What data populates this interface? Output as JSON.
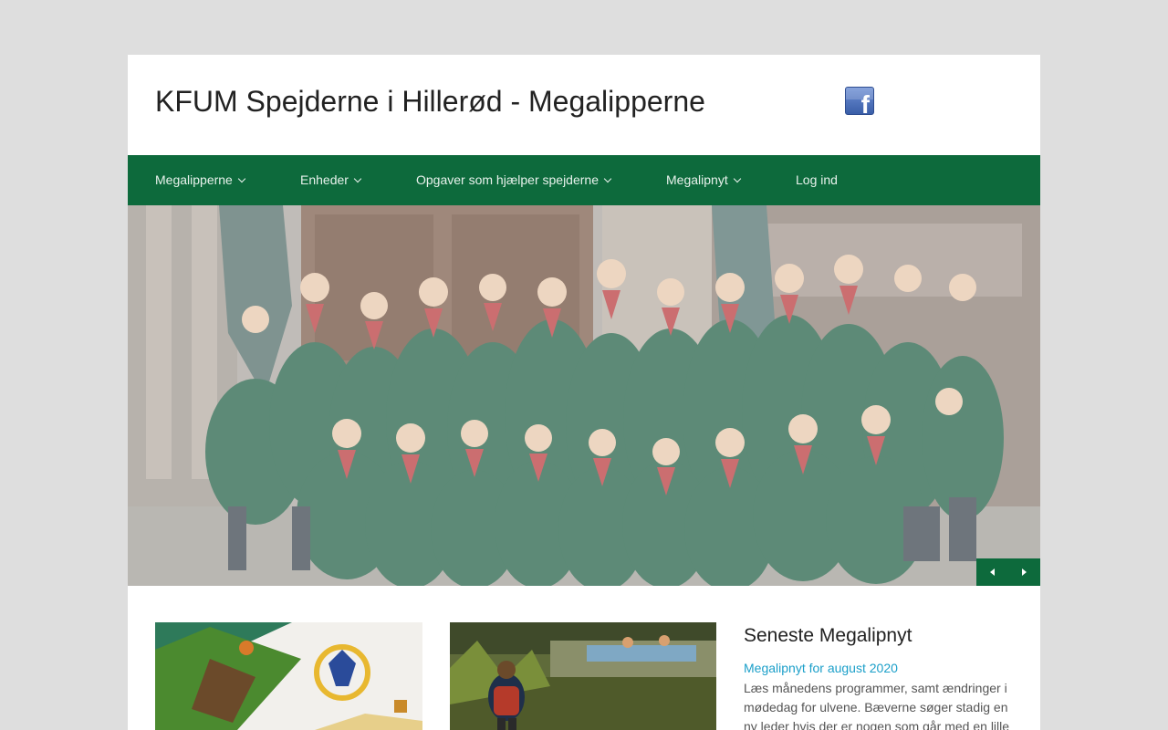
{
  "site": {
    "title": "KFUM Spejderne i Hillerød - Megalipperne"
  },
  "header": {
    "facebook_icon": "facebook-icon",
    "facebook_letter": "f"
  },
  "nav": {
    "items": [
      {
        "label": "Megalipperne",
        "has_dropdown": true
      },
      {
        "label": "Enheder",
        "has_dropdown": true
      },
      {
        "label": "Opgaver som hjælper spejderne",
        "has_dropdown": true
      },
      {
        "label": "Megalipnyt",
        "has_dropdown": true
      },
      {
        "label": "Log ind",
        "has_dropdown": false
      }
    ]
  },
  "hero": {
    "image": "group-photo-scouts",
    "prev_icon": "arrow-left-icon",
    "next_icon": "arrow-right-icon"
  },
  "sidebar_news": {
    "heading": "Seneste Megalipnyt",
    "items": [
      {
        "title": "Megalipnyt for august 2020",
        "excerpt": "Læs månedens programmer, samt ændringer i mødedag for ulvene. Bæverne søger stadig en ny leder hvis der er nogen som går med en lille"
      }
    ]
  },
  "colors": {
    "page_background": "#dedede",
    "nav_background": "#0d6a3c",
    "link": "#1b9fc9",
    "content_background": "#ffffff"
  }
}
